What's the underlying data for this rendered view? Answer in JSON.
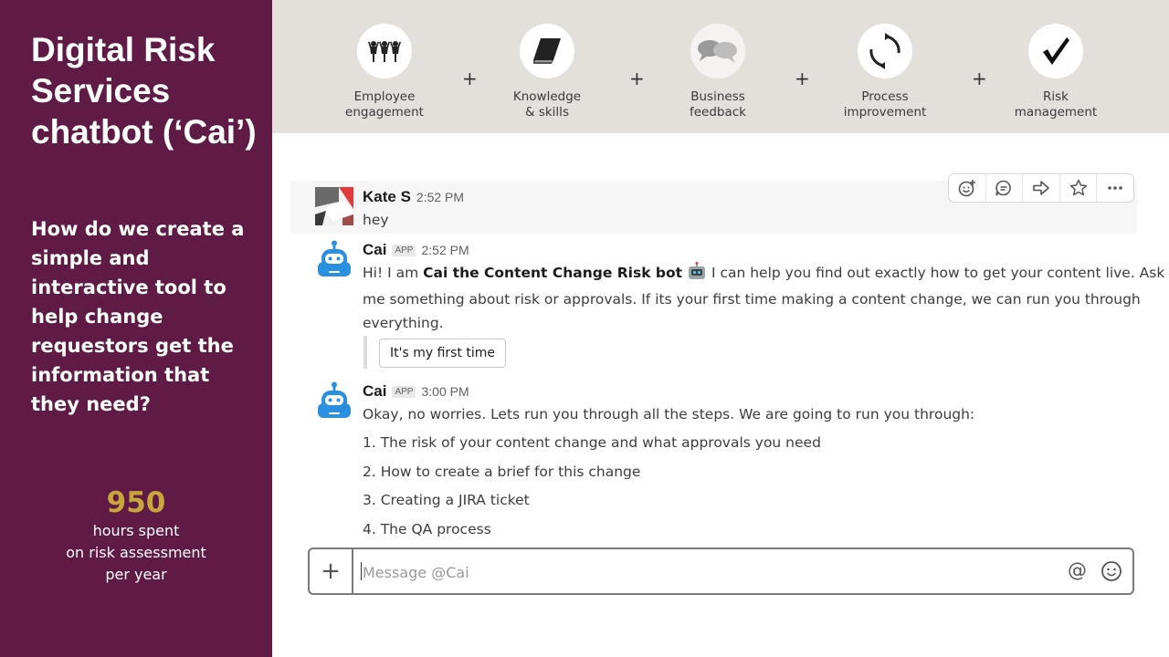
{
  "left_panel": {
    "title": "Digital Risk Services chatbot (‘Cai’)",
    "question": "How do we create a simple and interactive tool to help change requestors get the information that they need?",
    "stat_number": "950",
    "stat_caption_1": "hours spent",
    "stat_caption_2": "on risk assessment",
    "stat_caption_3": "per year",
    "accent_color": "#c9a63c",
    "background_color": "#5f1a45"
  },
  "steps": [
    {
      "icon": "people-icon",
      "line1": "Employee",
      "line2": "engagement"
    },
    {
      "icon": "book-icon",
      "line1": "Knowledge",
      "line2": "& skills"
    },
    {
      "icon": "speech-bubbles-icon",
      "line1": "Business",
      "line2": "feedback"
    },
    {
      "icon": "cycle-arrows-icon",
      "line1": "Process",
      "line2": "improvement"
    },
    {
      "icon": "checkmark-icon",
      "line1": "Risk",
      "line2": "management"
    }
  ],
  "plus_sign": "+",
  "messages": {
    "m1": {
      "author": "Kate S",
      "time": "2:52 PM",
      "text": "hey"
    },
    "m2": {
      "author": "Cai",
      "badge": "APP",
      "time": "2:52 PM",
      "text_pre": "Hi! I am ",
      "text_bold": "Cai the Content Change Risk bot",
      "text_line1_post": "I can help you find out exactly how to get your content live. Ask",
      "text_line2": "me something about risk or approvals. If its your first time making a content change, we can run you through",
      "text_line3": "everything.",
      "button": "It's my first time"
    },
    "m3": {
      "author": "Cai",
      "badge": "APP",
      "time": "3:00 PM",
      "text": "Okay, no worries. Lets run you through all the steps. We are going to run you through:",
      "items": [
        "1. The risk of your content change and what approvals you need",
        "2. How to create a brief for this change",
        "3. Creating a JIRA ticket",
        "4. The QA process"
      ]
    }
  },
  "message_actions": [
    "add-reaction-icon",
    "reply-thread-icon",
    "share-icon",
    "star-icon",
    "more-icon"
  ],
  "composer": {
    "add": "+",
    "placeholder": "Message @Cai",
    "at": "@",
    "emoji_icon": "smiley-icon"
  }
}
